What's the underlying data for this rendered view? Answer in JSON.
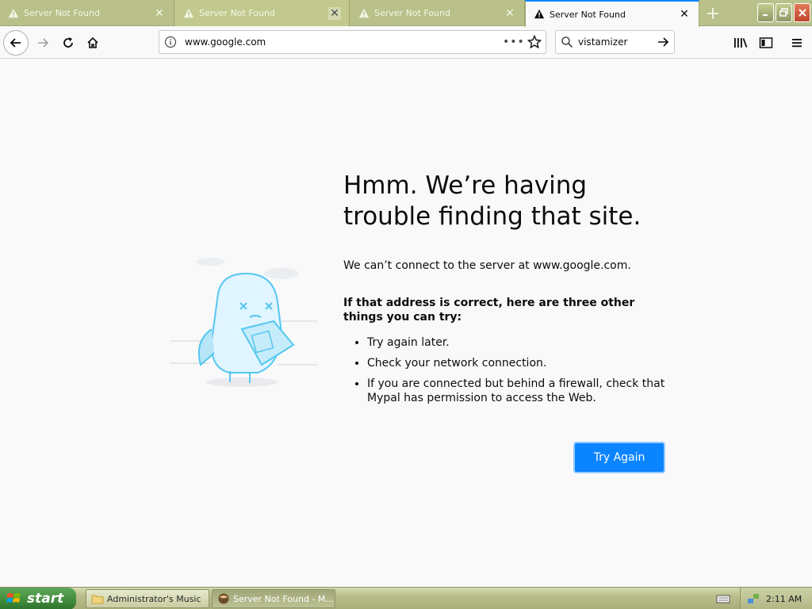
{
  "browser": {
    "tabs": [
      {
        "title": "Server Not Found",
        "state": "normal"
      },
      {
        "title": "Server Not Found",
        "state": "hovered"
      },
      {
        "title": "Server Not Found",
        "state": "normal"
      },
      {
        "title": "Server Not Found",
        "state": "active"
      }
    ],
    "new_tab_label": "+",
    "url": "www.google.com",
    "page_actions_label": "•••",
    "search_value": "vistamizer"
  },
  "page": {
    "title": "Hmm. We’re having trouble finding that site.",
    "description": "We can’t connect to the server at www.google.com.",
    "suggestions_heading": "If that address is correct, here are three other things you can try:",
    "suggestions": [
      "Try again later.",
      "Check your network connection.",
      "If you are connected but behind a firewall, check that Mypal has permission to access the Web."
    ],
    "try_again_label": "Try Again"
  },
  "taskbar": {
    "start_label": "start",
    "items": [
      {
        "label": "Administrator's Music",
        "active": false
      },
      {
        "label": "Server Not Found - M...",
        "active": true
      }
    ],
    "clock": "2:11 AM"
  },
  "colors": {
    "accent": "#0a84ff",
    "tabstrip": "#b9c08a",
    "page_bg": "#f9f9fa"
  }
}
